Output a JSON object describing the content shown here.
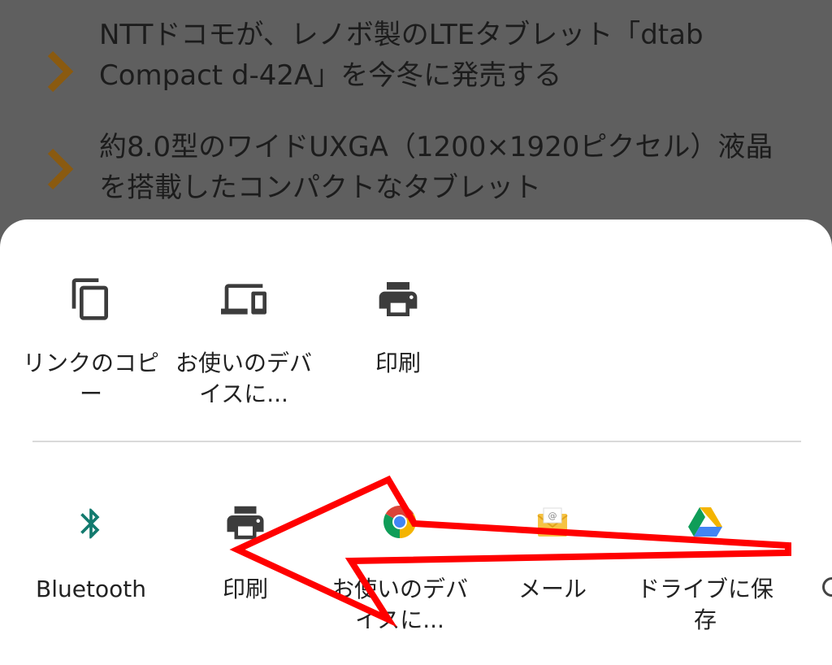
{
  "background_articles": [
    {
      "text": "NTTドコモが、レノボ製のLTEタブレット「dtab Compact d-42A」を今冬に発売する",
      "chevron_icon": "chevron-right-icon"
    },
    {
      "text": "約8.0型のワイドUXGA（1200×1920ピクセル）液晶を搭載したコンパクトなタブレット",
      "chevron_icon": "chevron-right-icon"
    }
  ],
  "share_sheet": {
    "quick_actions": [
      {
        "label": "リンクのコピー",
        "icon": "copy-icon"
      },
      {
        "label": "お使いのデバイスに...",
        "icon": "devices-icon"
      },
      {
        "label": "印刷",
        "icon": "print-icon"
      }
    ],
    "apps": [
      {
        "label": "Bluetooth",
        "icon": "bluetooth-icon"
      },
      {
        "label": "印刷",
        "icon": "print-icon"
      },
      {
        "label": "お使いのデバイスに...",
        "icon": "chrome-icon"
      },
      {
        "label": "メール",
        "icon": "mail-icon"
      },
      {
        "label": "ドライブに保存",
        "icon": "google-drive-icon"
      }
    ]
  },
  "annotation": {
    "type": "arrow",
    "color": "#ff0000"
  },
  "colors": {
    "chevron": "#8a5a10",
    "bluetooth": "#127a6e",
    "icon_gray": "#3c3c3c",
    "scrim_bg": "#5f5f5f",
    "sheet_bg": "#ffffff"
  }
}
